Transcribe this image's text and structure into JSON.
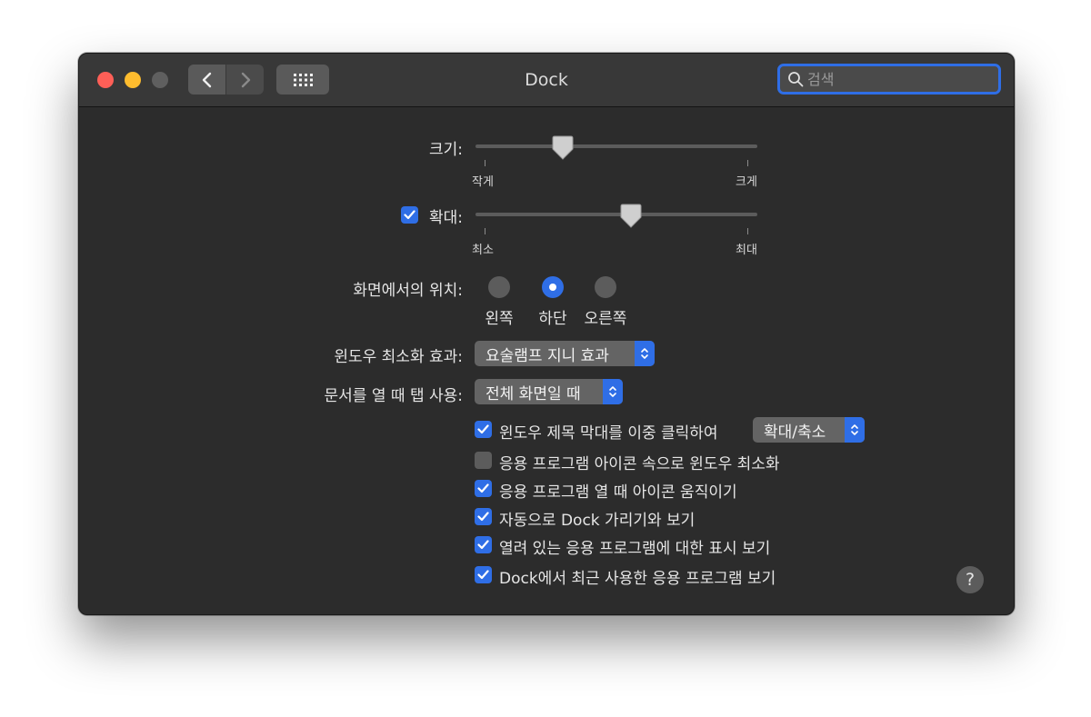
{
  "window": {
    "title": "Dock",
    "search": {
      "placeholder": "검색"
    }
  },
  "size": {
    "label": "크기:",
    "min_label": "작게",
    "max_label": "크게",
    "value": 0.31
  },
  "magnification": {
    "checked": true,
    "label": "확대:",
    "min_label": "최소",
    "max_label": "최대",
    "value": 0.55
  },
  "position": {
    "label": "화면에서의 위치:",
    "options": [
      {
        "label": "왼쪽",
        "selected": false
      },
      {
        "label": "하단",
        "selected": true
      },
      {
        "label": "오른쪽",
        "selected": false
      }
    ]
  },
  "minimize_effect": {
    "label": "윈도우 최소화 효과:",
    "value": "요술램프 지니 효과"
  },
  "prefer_tabs": {
    "label": "문서를 열 때 탭 사용:",
    "value": "전체 화면일 때"
  },
  "options": [
    {
      "label": "윈도우 제목 막대를 이중 클릭하여",
      "checked": true,
      "popup": "확대/축소"
    },
    {
      "label": "응용 프로그램 아이콘 속으로 윈도우 최소화",
      "checked": false
    },
    {
      "label": "응용 프로그램 열 때 아이콘 움직이기",
      "checked": true
    },
    {
      "label": "자동으로 Dock 가리기와 보기",
      "checked": true
    },
    {
      "label": "열려 있는 응용 프로그램에 대한 표시 보기",
      "checked": true
    },
    {
      "label": "Dock에서 최근 사용한 응용 프로그램 보기",
      "checked": true
    }
  ],
  "help": {
    "label": "?"
  },
  "colors": {
    "accent": "#2f6ee6",
    "close": "#fe5f57",
    "minimize": "#febc2e",
    "zoom_disabled": "#5f5f5f",
    "window_bg": "#2c2c2c"
  }
}
